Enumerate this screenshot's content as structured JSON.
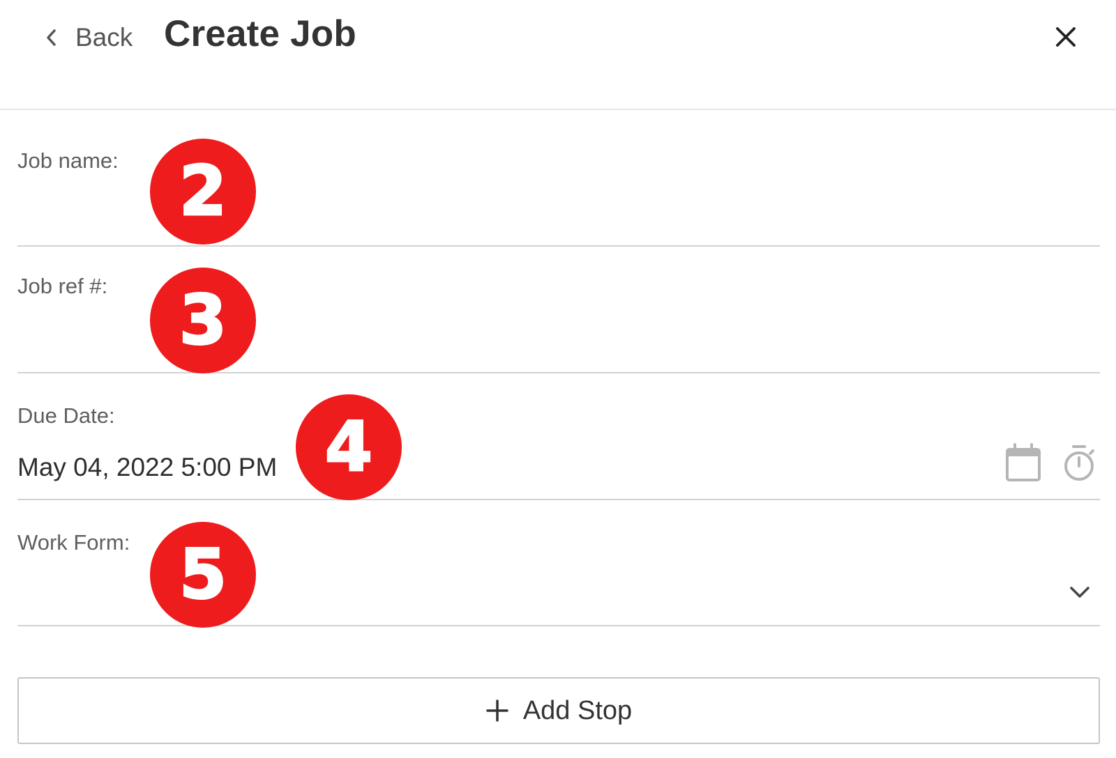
{
  "header": {
    "back_label": "Back",
    "title": "Create Job"
  },
  "fields": {
    "job_name": {
      "label": "Job name:",
      "value": ""
    },
    "job_ref": {
      "label": "Job ref #:",
      "value": ""
    },
    "due_date": {
      "label": "Due Date:",
      "value": "May 04, 2022 5:00 PM"
    },
    "work_form": {
      "label": "Work Form:",
      "value": ""
    }
  },
  "add_stop": {
    "label": "Add Stop"
  },
  "markers": [
    "2",
    "3",
    "4",
    "5"
  ],
  "icons": {
    "back": "chevron-left-icon",
    "close": "close-icon",
    "calendar": "calendar-icon",
    "timer": "timer-icon",
    "dropdown": "chevron-down-icon",
    "add": "plus-icon"
  },
  "colors": {
    "marker": "#ee1c1c",
    "divider": "#d2d2d2",
    "icon_gray": "#b5b5b5",
    "text": "#333333"
  }
}
